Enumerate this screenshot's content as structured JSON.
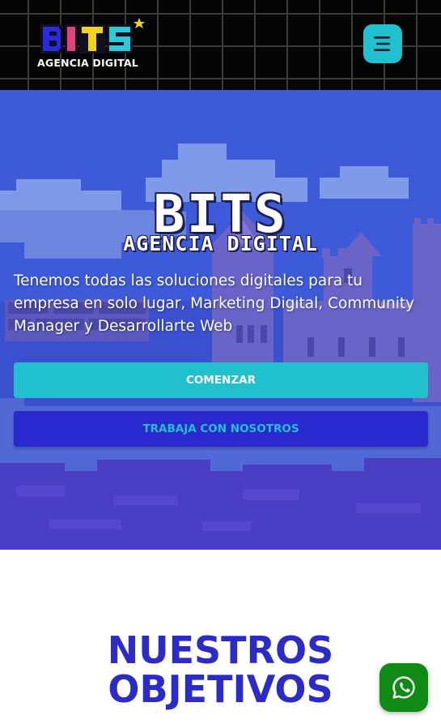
{
  "header": {
    "logo": {
      "letters": "BITS",
      "caption": "AGENCIA DIGITAL"
    },
    "menu_icon": "hamburger-menu-icon"
  },
  "hero": {
    "title": "BITS",
    "subtitle": "AGENCIA DIGITAL",
    "description": "Tenemos todas las soluciones digitales para tu empresa en solo lugar, Marketing Digital, Community Manager y Desarrollarte Web",
    "primary_button": "COMENZAR",
    "secondary_button": "TRABAJA CON NOSOTROS"
  },
  "objetivos": {
    "title_line1": "NUESTROS",
    "title_line2": "OBJETIVOS"
  },
  "floating": {
    "whatsapp_icon": "whatsapp-icon"
  },
  "colors": {
    "header_bg": "#050505",
    "hero_bg": "#3d59d6",
    "accent_cyan": "#21c0cf",
    "accent_blue": "#2a29cf",
    "heading_blue": "#2b2bc9",
    "whatsapp_green": "#0f8a14"
  }
}
